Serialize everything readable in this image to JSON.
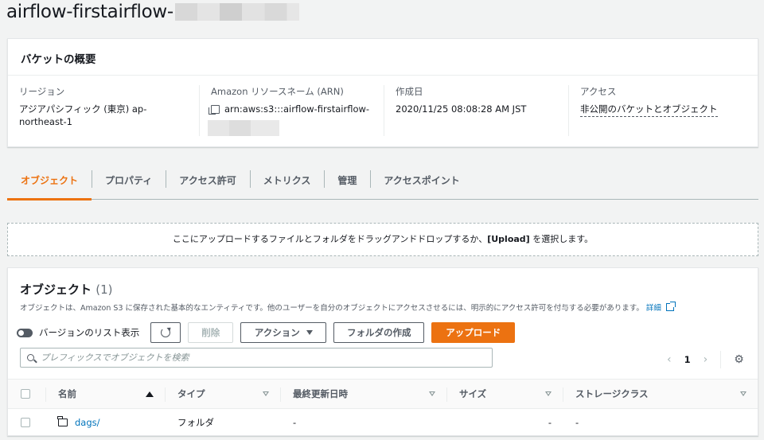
{
  "page": {
    "title": "airflow-firstairflow-"
  },
  "overview": {
    "header": "バケットの概要",
    "region": {
      "label": "リージョン",
      "value": "アジアパシフィック (東京) ap-northeast-1"
    },
    "arn": {
      "label": "Amazon リソースネーム (ARN)",
      "value": "arn:aws:s3:::airflow-firstairflow-"
    },
    "created": {
      "label": "作成日",
      "value": "2020/11/25 08:08:28 AM JST"
    },
    "access": {
      "label": "アクセス",
      "value": "非公開のバケットとオブジェクト"
    }
  },
  "tabs": [
    {
      "label": "オブジェクト",
      "active": true
    },
    {
      "label": "プロパティ",
      "active": false
    },
    {
      "label": "アクセス許可",
      "active": false
    },
    {
      "label": "メトリクス",
      "active": false
    },
    {
      "label": "管理",
      "active": false
    },
    {
      "label": "アクセスポイント",
      "active": false
    }
  ],
  "dropzone": {
    "text_before": "ここにアップロードするファイルとフォルダをドラッグアンドドロップするか、",
    "upload_keyword": "[Upload]",
    "text_after": " を選択します。"
  },
  "objects": {
    "title": "オブジェクト",
    "count": "(1)",
    "description": "オブジェクトは、Amazon S3 に保存された基本的なエンティティです。他のユーザーを自分のオブジェクトにアクセスさせるには、明示的にアクセス許可を付与する必要があります。",
    "details_link": "詳細",
    "toolbar": {
      "versions_toggle_label": "バージョンのリスト表示",
      "delete_label": "削除",
      "actions_label": "アクション",
      "create_folder_label": "フォルダの作成",
      "upload_label": "アップロード"
    },
    "search_placeholder": "プレフィックスでオブジェクトを検索",
    "pager": {
      "prev": "‹",
      "page": "1",
      "next": "›"
    },
    "columns": [
      "名前",
      "タイプ",
      "最終更新日時",
      "サイズ",
      "ストレージクラス"
    ],
    "rows": [
      {
        "name": "dags/",
        "type": "フォルダ",
        "modified": "-",
        "size": "-",
        "storage_class": "-"
      }
    ]
  },
  "colors": {
    "accent": "#ec7211",
    "link": "#0073bb",
    "background": "#f2f3f3"
  },
  "icons": [
    "copy-icon",
    "refresh-icon",
    "caret-down-icon",
    "search-icon",
    "chevron-left-icon",
    "chevron-right-icon",
    "gear-icon",
    "folder-icon",
    "external-link-icon",
    "sort-asc-icon",
    "sort-desc-icon"
  ]
}
